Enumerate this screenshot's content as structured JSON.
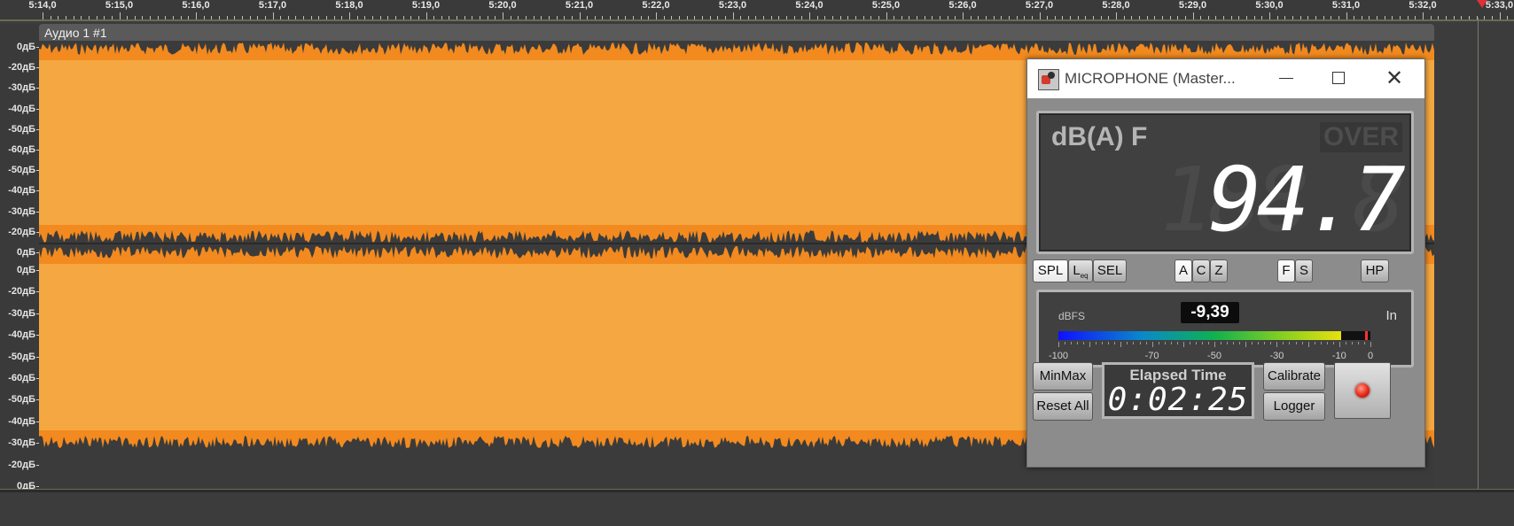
{
  "timeline": {
    "ticks": [
      "5:14,0",
      "5:15,0",
      "5:16,0",
      "5:17,0",
      "5:18,0",
      "5:19,0",
      "5:20,0",
      "5:21,0",
      "5:22,0",
      "5:23,0",
      "5:24,0",
      "5:25,0",
      "5:26,0",
      "5:27,0",
      "5:28,0",
      "5:29,0",
      "5:30,0",
      "5:31,0",
      "5:32,0",
      "5:33,0"
    ]
  },
  "track": {
    "title": "Аудио 1 #1",
    "db_scale_top": [
      "0дБ",
      "-20дБ",
      "-30дБ",
      "-40дБ",
      "-50дБ",
      "-60дБ",
      "-50дБ",
      "-40дБ",
      "-30дБ",
      "-20дБ",
      "0дБ"
    ],
    "db_scale_bottom": [
      "0дБ",
      "-20дБ",
      "-30дБ",
      "-40дБ",
      "-50дБ",
      "-60дБ",
      "-50дБ",
      "-40дБ",
      "-30дБ",
      "-20дБ",
      "0дБ"
    ],
    "colors": {
      "waveform": "#f5a741",
      "waveform_edge": "#f28a1f",
      "background": "#3b3b3b"
    }
  },
  "meter_window": {
    "title": "MICROPHONE (Master...",
    "mode_label": "dB(A) F",
    "over_label": "OVER",
    "reading": "94.7",
    "reading_background": "188.8",
    "buttons": {
      "spl": "SPL",
      "leq": "L",
      "leq_sub": "eq",
      "sel": "SEL",
      "a": "A",
      "c": "C",
      "z": "Z",
      "f": "F",
      "s": "S",
      "hp": "HP"
    },
    "dbfs_label": "dBFS",
    "dbfs_value": "-9,39",
    "input_label": "In",
    "level_meter": {
      "min": -100,
      "max": 0,
      "level": -9.39,
      "peak": -1.5
    },
    "scale_labels": [
      "-100",
      "-70",
      "-50",
      "-30",
      "-10",
      "0"
    ],
    "minmax": "MinMax",
    "reset_all": "Reset All",
    "elapsed_title": "Elapsed Time",
    "elapsed_time": "0:02:25",
    "calibrate": "Calibrate",
    "logger": "Logger"
  }
}
